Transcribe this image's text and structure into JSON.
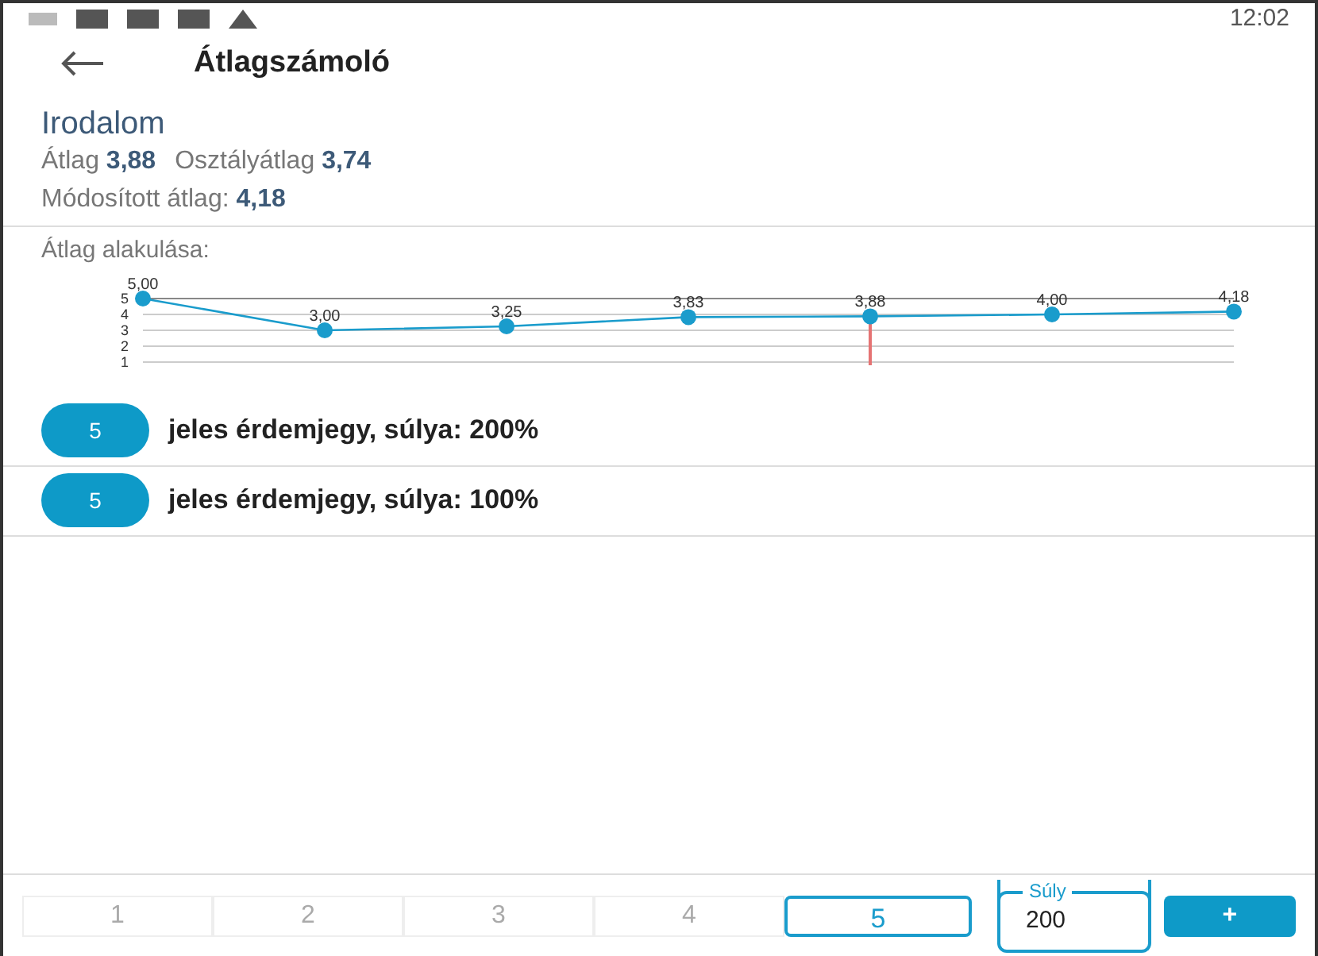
{
  "status_bar": {
    "time": "12:02"
  },
  "header": {
    "title": "Átlagszámoló"
  },
  "subject": {
    "name": "Irodalom",
    "average_label": "Átlag",
    "average": "3,88",
    "class_average_label": "Osztályátlag",
    "class_average": "3,74",
    "modified_label": "Módosított átlag:",
    "modified": "4,18"
  },
  "chart_title": "Átlag alakulása:",
  "chart_data": {
    "type": "line",
    "series": [
      {
        "color": "#1a9ccc",
        "marker": "o",
        "values": [
          5,
          3,
          3.25,
          3.83,
          3.88,
          4,
          4.18
        ]
      }
    ],
    "ylim": [
      1,
      5
    ],
    "yticks": [
      1,
      2,
      3,
      4,
      5
    ],
    "grid": true,
    "value_labels": [
      "5,00",
      "3,00",
      "3,25",
      "3,83",
      "3,88",
      "4,00",
      "4,18"
    ]
  },
  "grades": [
    {
      "grade": "5",
      "text": "jeles érdemjegy, súlya: 200%"
    },
    {
      "grade": "5",
      "text": "jeles érdemjegy, súlya: 100%"
    }
  ],
  "grade_picker": [
    {
      "label": "1",
      "selected": false
    },
    {
      "label": "2",
      "selected": false
    },
    {
      "label": "3",
      "selected": false
    },
    {
      "label": "4",
      "selected": false
    },
    {
      "label": "5",
      "selected": true
    }
  ],
  "weight_field": {
    "label": "Súly",
    "value": "200"
  },
  "add_button": {
    "label": "+"
  }
}
